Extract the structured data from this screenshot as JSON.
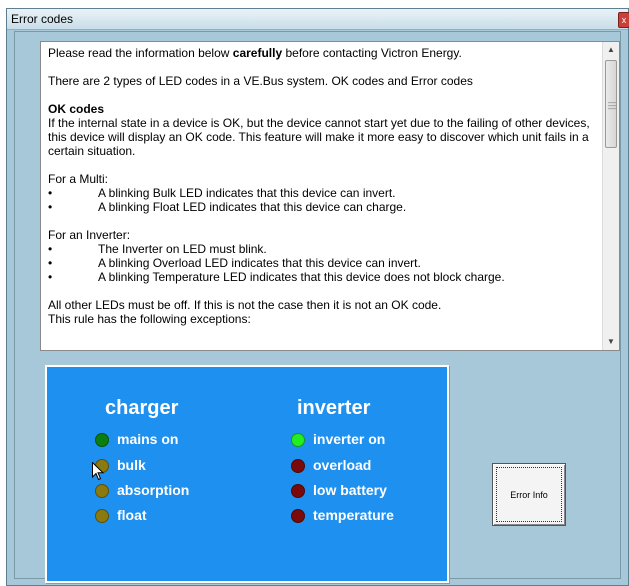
{
  "window": {
    "title": "Error codes",
    "close_glyph": "x"
  },
  "info": {
    "intro_pre": "Please read the information below ",
    "intro_bold": "carefully",
    "intro_post": " before contacting Victron Energy.",
    "types": "There are 2 types of LED codes in a VE.Bus system. OK codes and Error codes",
    "ok_heading": "OK codes",
    "ok_paragraph": "If the internal state in a device is OK, but the device cannot start yet due to the failing of other devices, this device will display an OK code. This feature will make it more easy to discover which unit fails in a certain situation.",
    "multi_heading": "For a Multi:",
    "multi_items": [
      "A blinking Bulk LED indicates that this device can invert.",
      "A blinking Float LED indicates that this device can charge."
    ],
    "inverter_heading": "For an Inverter:",
    "inverter_items": [
      "The Inverter on LED must blink.",
      "A blinking Overload LED  indicates that this device can invert.",
      "A blinking Temperature LED indicates that this device does not block charge."
    ],
    "all_other": "All other LEDs must be off. If this is not the case then it is not an OK code.",
    "exceptions": "This rule has the following exceptions:",
    "bullet_glyph": "•"
  },
  "panel": {
    "charger_title": "charger",
    "inverter_title": "inverter",
    "charger_leds": [
      {
        "label": "mains on",
        "color": "#0a7f10"
      },
      {
        "label": "bulk",
        "color": "#8a7a10"
      },
      {
        "label": "absorption",
        "color": "#8a7a10"
      },
      {
        "label": "float",
        "color": "#8a7a10"
      }
    ],
    "inverter_leds": [
      {
        "label": "inverter on",
        "color": "#22ee22"
      },
      {
        "label": "overload",
        "color": "#7a0a0a"
      },
      {
        "label": "low battery",
        "color": "#7a0a0a"
      },
      {
        "label": "temperature",
        "color": "#7a0a0a"
      }
    ]
  },
  "error_button": {
    "label": "Error Info"
  },
  "colors": {
    "panel_blue": "#1e90f0",
    "window_bg": "#a6c8d8"
  }
}
